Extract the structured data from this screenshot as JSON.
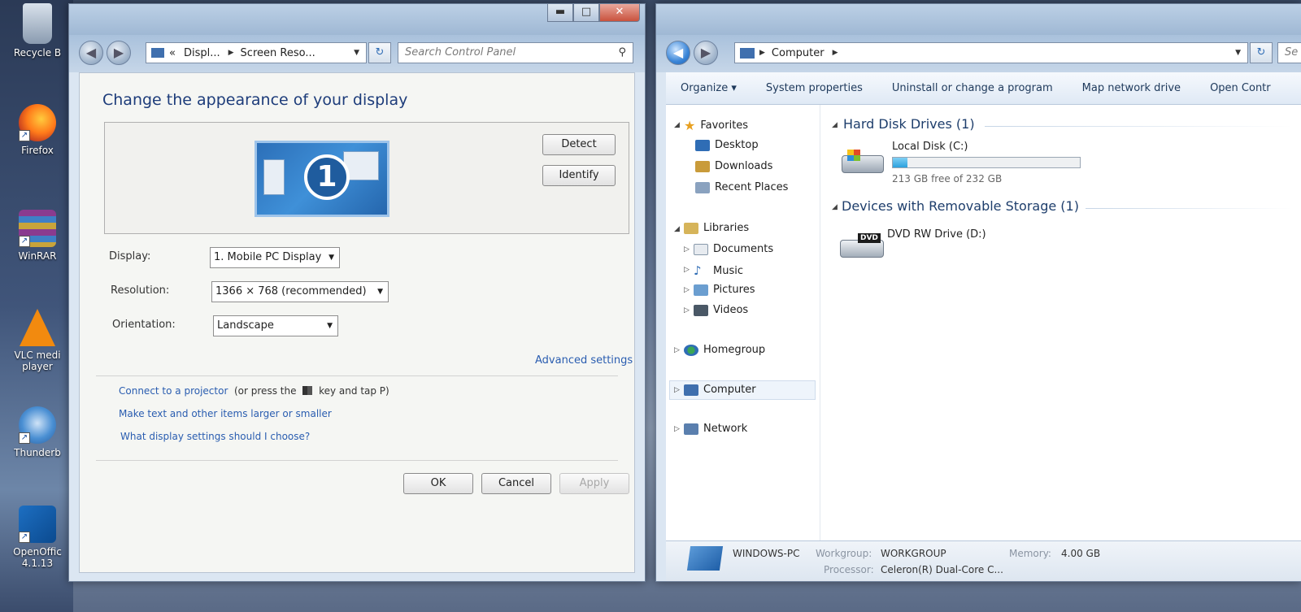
{
  "desktop": {
    "icons": [
      {
        "label": "Recycle B",
        "icon": "recycle-bin-icon"
      },
      {
        "label": "Firefox",
        "icon": "firefox-icon"
      },
      {
        "label": "WinRAR",
        "icon": "winrar-icon"
      },
      {
        "label": "VLC medi player",
        "icon": "vlc-icon"
      },
      {
        "label": "Thunderb",
        "icon": "thunderbird-icon"
      },
      {
        "label": "OpenOffic 4.1.13",
        "icon": "openoffice-icon"
      }
    ]
  },
  "control_panel": {
    "window_buttons": {
      "minimize": "▬",
      "maximize": "□",
      "close": "✕"
    },
    "breadcrumb": {
      "prefix": "«",
      "items": [
        "Displ...",
        "Screen Reso..."
      ]
    },
    "search_placeholder": "Search Control Panel",
    "title": "Change the appearance of your display",
    "monitor_number": "1",
    "detect_label": "Detect",
    "identify_label": "Identify",
    "display_label": "Display:",
    "display_value": "1. Mobile PC Display",
    "resolution_label": "Resolution:",
    "resolution_value": "1366 × 768 (recommended)",
    "orientation_label": "Orientation:",
    "orientation_value": "Landscape",
    "advanced_link": "Advanced settings",
    "projector_link": "Connect to a projector",
    "projector_hint_a": "(or press the",
    "projector_hint_b": "key and tap P)",
    "text_size_link": "Make text and other items larger or smaller",
    "settings_help_link": "What display settings should I choose?",
    "ok_label": "OK",
    "cancel_label": "Cancel",
    "apply_label": "Apply"
  },
  "explorer": {
    "address": "Computer",
    "search_partial": "Se",
    "commands": [
      "Organize ▾",
      "System properties",
      "Uninstall or change a program",
      "Map network drive",
      "Open Contr"
    ],
    "nav": {
      "favorites": "Favorites",
      "desktop": "Desktop",
      "downloads": "Downloads",
      "recent": "Recent Places",
      "libraries": "Libraries",
      "documents": "Documents",
      "music": "Music",
      "pictures": "Pictures",
      "videos": "Videos",
      "homegroup": "Homegroup",
      "computer": "Computer",
      "network": "Network"
    },
    "hdd_group": "Hard Disk Drives (1)",
    "local_disk": "Local Disk (C:)",
    "local_disk_free": "213 GB free of 232 GB",
    "local_disk_used_fraction": 0.08,
    "removable_group": "Devices with Removable Storage (1)",
    "dvd_badge": "DVD",
    "dvd_drive": "DVD RW Drive (D:)",
    "details": {
      "pc_name": "WINDOWS-PC",
      "workgroup_label": "Workgroup:",
      "workgroup_value": "WORKGROUP",
      "memory_label": "Memory:",
      "memory_value": "4.00 GB",
      "processor_label": "Processor:",
      "processor_value": "Celeron(R) Dual-Core C..."
    }
  }
}
